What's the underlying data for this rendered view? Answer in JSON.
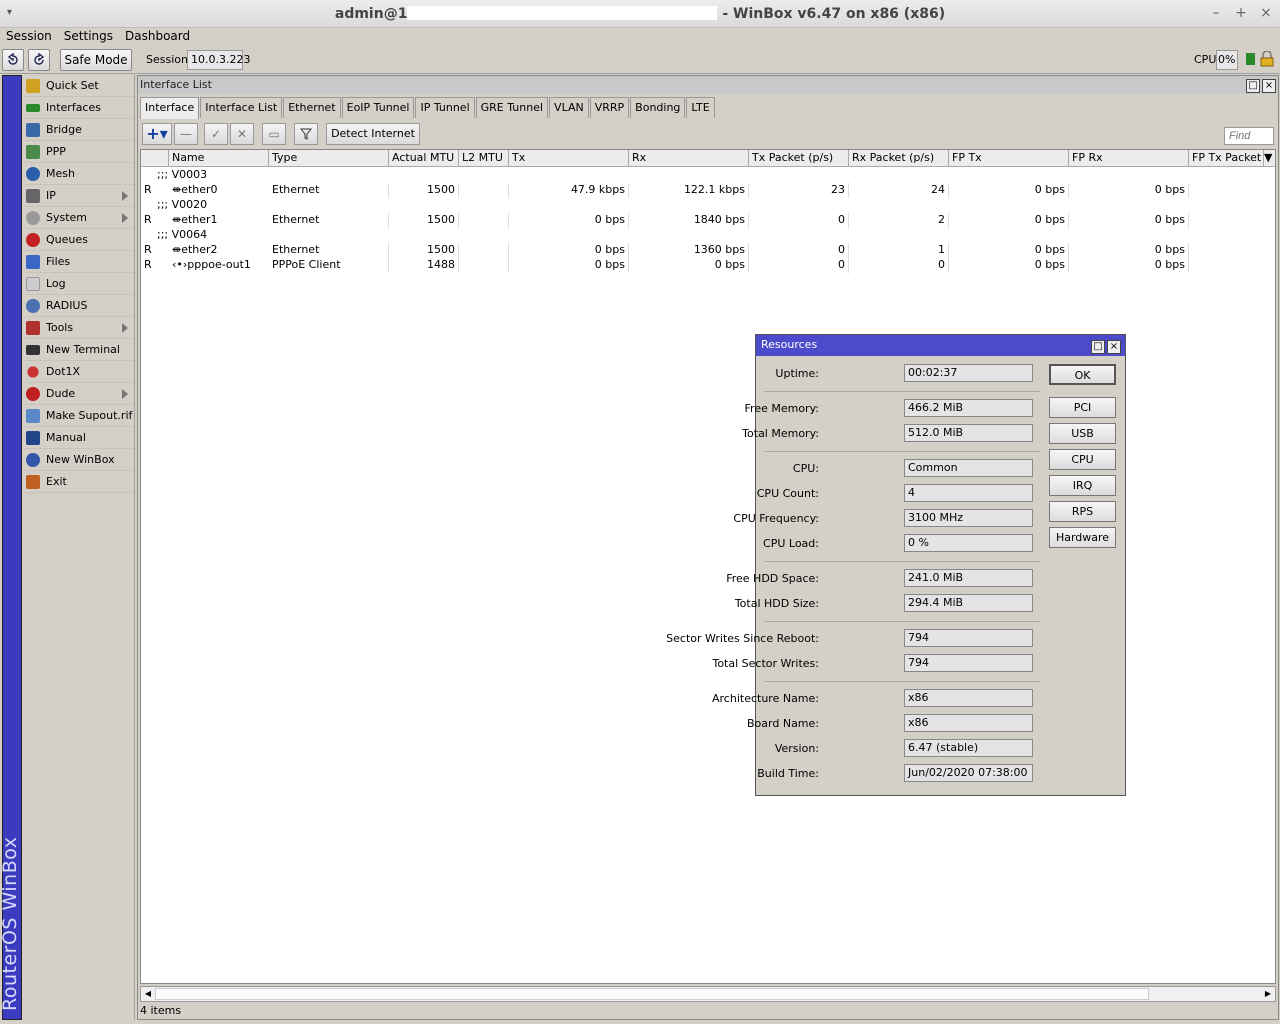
{
  "window": {
    "title_prefix": "admin@1",
    "title_suffix": "- WinBox v6.47 on x86 (x86)"
  },
  "menubar": [
    "Session",
    "Settings",
    "Dashboard"
  ],
  "toolbar": {
    "safe_mode": "Safe Mode",
    "session_label": "Session:",
    "session_value": "10.0.3.223",
    "cpu_label": "CPU:",
    "cpu_value": "0%"
  },
  "sidebar": {
    "brand": "RouterOS WinBox",
    "items": [
      {
        "label": "Quick Set",
        "icon": "wand-icon",
        "color": "#d0a020"
      },
      {
        "label": "Interfaces",
        "icon": "interfaces-icon",
        "color": "#2a8a2a"
      },
      {
        "label": "Bridge",
        "icon": "bridge-icon",
        "color": "#3a6aa8"
      },
      {
        "label": "PPP",
        "icon": "ppp-icon",
        "color": "#4a8a4a"
      },
      {
        "label": "Mesh",
        "icon": "mesh-icon",
        "color": "#2a5ea8"
      },
      {
        "label": "IP",
        "icon": "ip-icon",
        "color": "#666666"
      },
      {
        "label": "System",
        "icon": "system-icon",
        "color": "#888888"
      },
      {
        "label": "Queues",
        "icon": "queues-icon",
        "color": "#c02020"
      },
      {
        "label": "Files",
        "icon": "files-icon",
        "color": "#3a66c8"
      },
      {
        "label": "Log",
        "icon": "log-icon",
        "color": "#cccccc"
      },
      {
        "label": "RADIUS",
        "icon": "radius-icon",
        "color": "#4a70b0"
      },
      {
        "label": "Tools",
        "icon": "tools-icon",
        "color": "#b03030"
      },
      {
        "label": "New Terminal",
        "icon": "terminal-icon",
        "color": "#333333"
      },
      {
        "label": "Dot1X",
        "icon": "dot1x-icon",
        "color": "#cc3333"
      },
      {
        "label": "Dude",
        "icon": "dude-icon",
        "color": "#c02020"
      },
      {
        "label": "Make Supout.rif",
        "icon": "supout-icon",
        "color": "#5a8ac8"
      },
      {
        "label": "Manual",
        "icon": "manual-icon",
        "color": "#224488"
      },
      {
        "label": "New WinBox",
        "icon": "winbox-icon",
        "color": "#3355aa"
      },
      {
        "label": "Exit",
        "icon": "exit-icon",
        "color": "#c06020"
      }
    ]
  },
  "iface_window": {
    "title": "Interface List",
    "tabs": [
      "Interface",
      "Interface List",
      "Ethernet",
      "EoIP Tunnel",
      "IP Tunnel",
      "GRE Tunnel",
      "VLAN",
      "VRRP",
      "Bonding",
      "LTE"
    ],
    "detect_internet": "Detect Internet",
    "find_placeholder": "Find",
    "columns": [
      "Name",
      "Type",
      "Actual MTU",
      "L2 MTU",
      "Tx",
      "Rx",
      "Tx Packet (p/s)",
      "Rx Packet (p/s)",
      "FP Tx",
      "FP Rx",
      "FP Tx Packet (p"
    ],
    "groups": [
      {
        "comment": ";;; V0003",
        "rows": [
          {
            "flag": "R",
            "name": "ether0",
            "type": "Ethernet",
            "mtu": "1500",
            "l2mtu": "",
            "tx": "47.9 kbps",
            "rx": "122.1 kbps",
            "txp": "23",
            "rxp": "24",
            "fptx": "0 bps",
            "fprx": "0 bps"
          }
        ]
      },
      {
        "comment": ";;; V0020",
        "rows": [
          {
            "flag": "R",
            "name": "ether1",
            "type": "Ethernet",
            "mtu": "1500",
            "l2mtu": "",
            "tx": "0 bps",
            "rx": "1840 bps",
            "txp": "0",
            "rxp": "2",
            "fptx": "0 bps",
            "fprx": "0 bps"
          }
        ]
      },
      {
        "comment": ";;; V0064",
        "rows": [
          {
            "flag": "R",
            "name": "ether2",
            "type": "Ethernet",
            "mtu": "1500",
            "l2mtu": "",
            "tx": "0 bps",
            "rx": "1360 bps",
            "txp": "0",
            "rxp": "1",
            "fptx": "0 bps",
            "fprx": "0 bps"
          },
          {
            "flag": "R",
            "name": "pppoe-out1",
            "type": "PPPoE Client",
            "mtu": "1488",
            "l2mtu": "",
            "tx": "0 bps",
            "rx": "0 bps",
            "txp": "0",
            "rxp": "0",
            "fptx": "0 bps",
            "fprx": "0 bps"
          }
        ]
      }
    ],
    "status": "4 items"
  },
  "resources": {
    "title": "Resources",
    "fields": {
      "uptime": {
        "label": "Uptime:",
        "value": "00:02:37"
      },
      "free_mem": {
        "label": "Free Memory:",
        "value": "466.2 MiB"
      },
      "total_mem": {
        "label": "Total Memory:",
        "value": "512.0 MiB"
      },
      "cpu": {
        "label": "CPU:",
        "value": "Common"
      },
      "cpu_count": {
        "label": "CPU Count:",
        "value": "4"
      },
      "cpu_freq": {
        "label": "CPU Frequency:",
        "value": "3100 MHz"
      },
      "cpu_load": {
        "label": "CPU Load:",
        "value": "0 %"
      },
      "free_hdd": {
        "label": "Free HDD Space:",
        "value": "241.0 MiB"
      },
      "total_hdd": {
        "label": "Total HDD Size:",
        "value": "294.4 MiB"
      },
      "sector_writes": {
        "label": "Sector Writes Since Reboot:",
        "value": "794"
      },
      "total_sector": {
        "label": "Total Sector Writes:",
        "value": "794"
      },
      "arch": {
        "label": "Architecture Name:",
        "value": "x86"
      },
      "board": {
        "label": "Board Name:",
        "value": "x86"
      },
      "version": {
        "label": "Version:",
        "value": "6.47 (stable)"
      },
      "build": {
        "label": "Build Time:",
        "value": "Jun/02/2020 07:38:00"
      }
    },
    "buttons": {
      "ok": "OK",
      "pci": "PCI",
      "usb": "USB",
      "cpu": "CPU",
      "irq": "IRQ",
      "rps": "RPS",
      "hardware": "Hardware"
    }
  }
}
